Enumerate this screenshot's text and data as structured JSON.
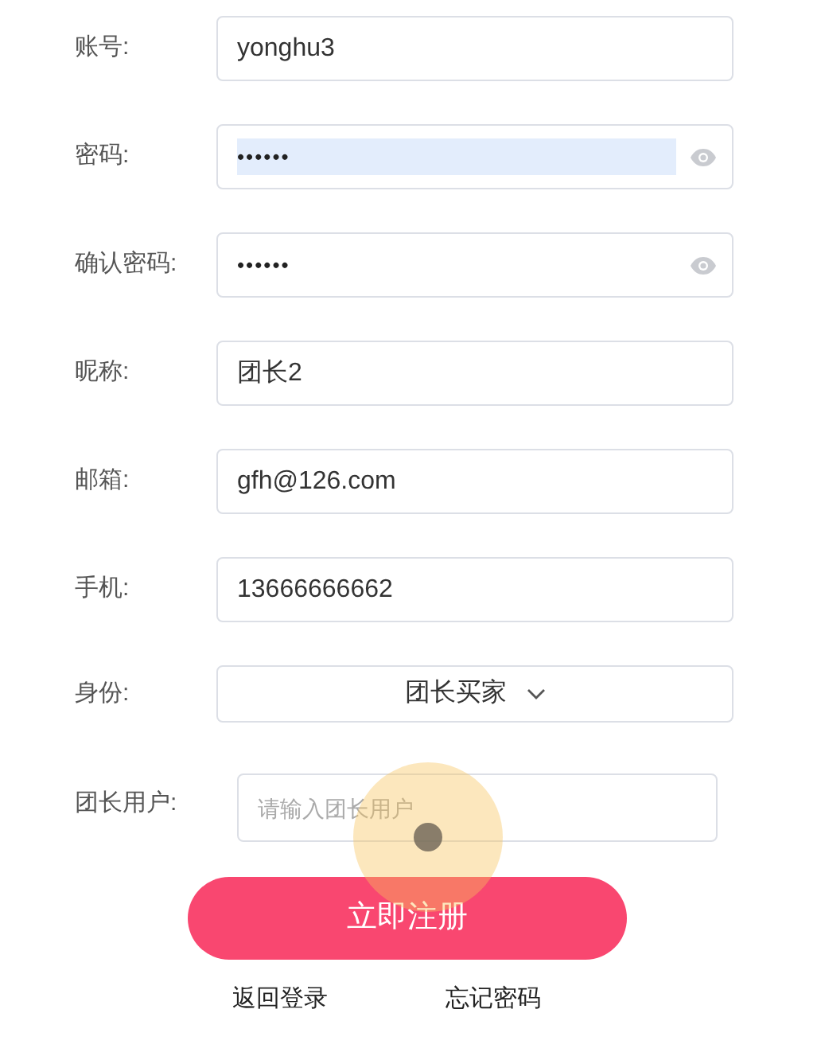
{
  "fields": [
    {
      "kind": "text",
      "label": "账号:",
      "value": "yonghu3"
    },
    {
      "kind": "password",
      "label": "密码:",
      "value": "••••••",
      "highlighted": true
    },
    {
      "kind": "password",
      "label": "确认密码:",
      "value": "••••••",
      "highlighted": false
    },
    {
      "kind": "text",
      "label": "昵称:",
      "value": "团长2"
    },
    {
      "kind": "text",
      "label": "邮箱:",
      "value": "gfh@126.com"
    },
    {
      "kind": "text",
      "label": "手机:",
      "value": "13666666662"
    },
    {
      "kind": "select",
      "label": "身份:",
      "value": "团长买家"
    },
    {
      "kind": "placeholder",
      "label": "团长用户:",
      "placeholder": "请输入团长用户"
    }
  ],
  "submit_button": "立即注册",
  "links": [
    "返回登录",
    "忘记密码"
  ]
}
